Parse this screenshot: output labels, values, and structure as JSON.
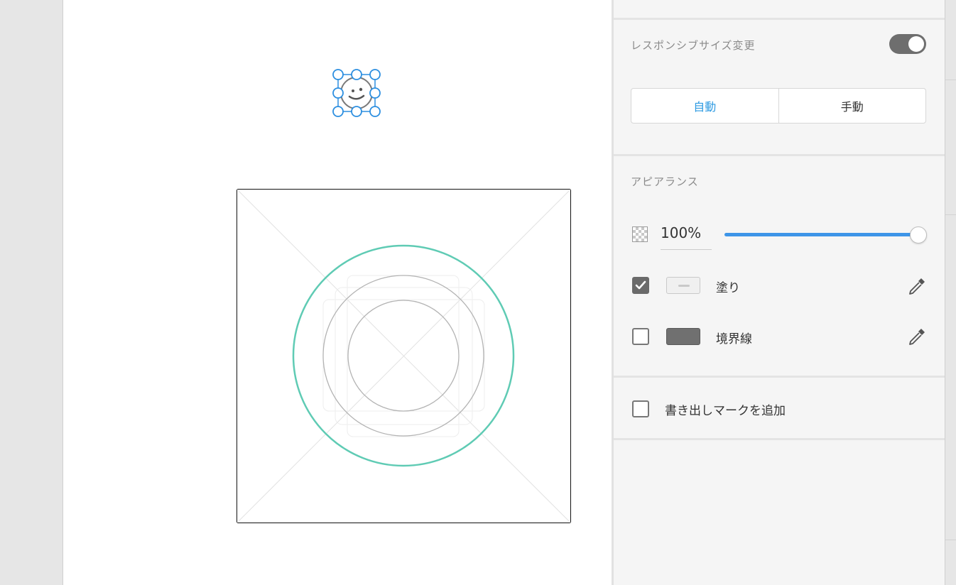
{
  "panel": {
    "responsive_label": "レスポンシブサイズ変更",
    "responsive_toggle_on": true,
    "resize_modes": [
      "自動",
      "手動"
    ],
    "resize_selected": "自動",
    "appearance_label": "アピアランス",
    "opacity_value": "100%",
    "opacity_level": 1.0,
    "fill_label": "塗り",
    "fill_checked": true,
    "border_label": "境界線",
    "border_checked": false,
    "export_label": "書き出しマークを追加",
    "export_checked": false
  },
  "colors": {
    "accent": "#2d9ae2",
    "slider": "#3d95e8",
    "selection": "#2d8fe0",
    "circle_highlight": "#5fcbb4",
    "toggle_on": "#6e6e6e",
    "stroke_swatch": "#707070"
  },
  "icons": {
    "canvas_glyph": "smiley-icon",
    "opacity": "checkerboard-icon",
    "fill_picker": "eyedropper-icon",
    "border_picker": "eyedropper-icon"
  }
}
